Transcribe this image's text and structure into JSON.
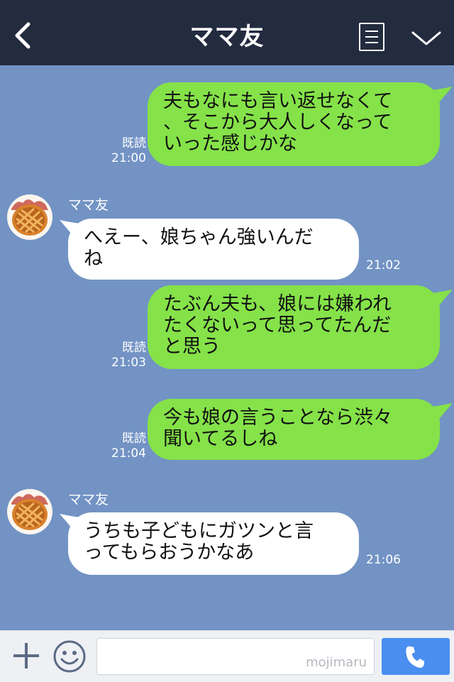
{
  "header": {
    "title": "ママ友"
  },
  "messages": [
    {
      "side": "me",
      "text": "夫もなにも言い返せなくて\n、そこから大人しくなって\nいった感じかな",
      "read": "既読",
      "time": "21:00"
    },
    {
      "side": "them",
      "name": "ママ友",
      "text": "へえー、娘ちゃん強いんだ\nね",
      "time": "21:02"
    },
    {
      "side": "me",
      "text": "たぶん夫も、娘には嫌われ\nたくないって思ってたんだ\nと思う",
      "read": "既読",
      "time": "21:03"
    },
    {
      "side": "me",
      "text": "今も娘の言うことなら渋々\n聞いてるしね",
      "read": "既読",
      "time": "21:04"
    },
    {
      "side": "them",
      "name": "ママ友",
      "text": "うちも子どもにガツンと言\nってもらおうかなあ",
      "time": "21:06"
    }
  ],
  "footer": {
    "watermark": "mojimaru"
  },
  "colors": {
    "header_bg": "#232b3f",
    "chat_bg": "#7293c4",
    "my_bubble": "#85e249",
    "their_bubble": "#ffffff",
    "call_button": "#4a8ef0"
  }
}
